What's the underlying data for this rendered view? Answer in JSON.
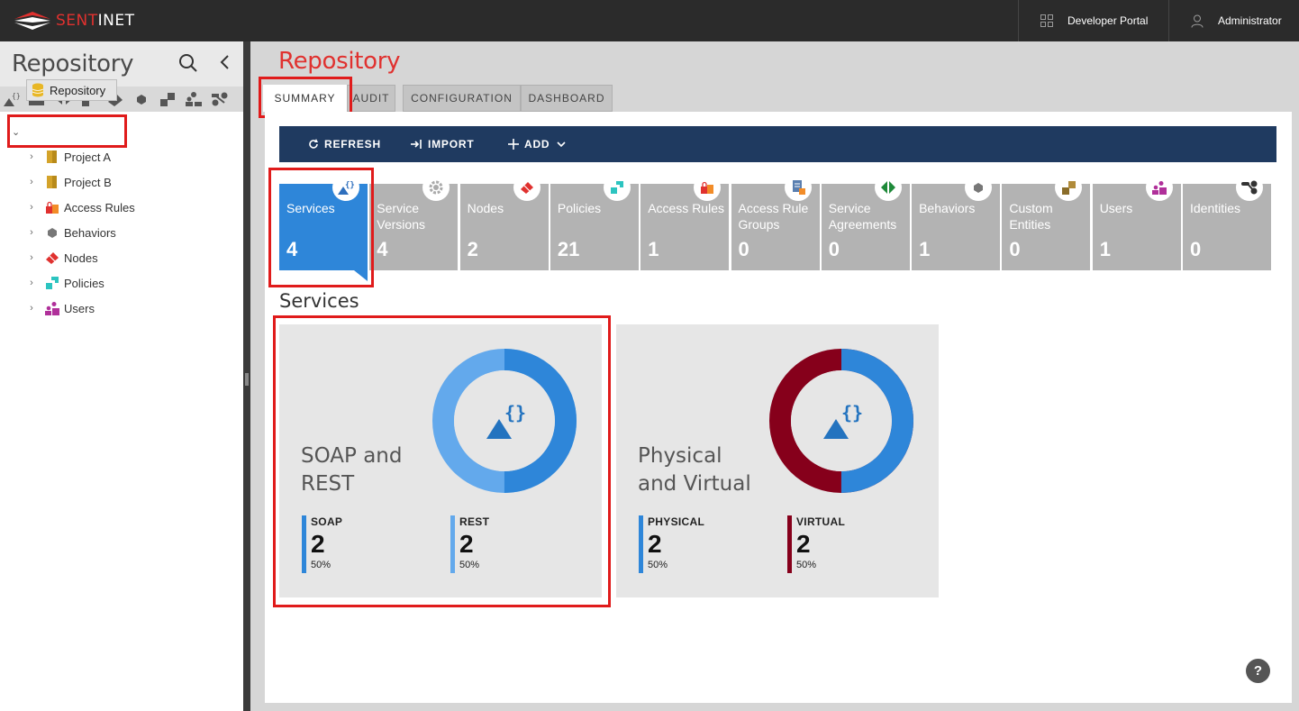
{
  "app": {
    "logo_text_red": "SENT",
    "logo_text_white": "INET"
  },
  "topbar": {
    "developer_portal": "Developer Portal",
    "user": "Administrator"
  },
  "left": {
    "title": "Repository",
    "toolbar_icons": [
      "service-icon",
      "access-rule-icon",
      "service-agreement-icon",
      "policy-icon",
      "node-icon",
      "behavior-icon",
      "custom-entity-icon",
      "users-icon",
      "identity-icon"
    ],
    "root": "Repository",
    "tree": [
      {
        "label": "Project A",
        "icon": "project-icon",
        "color": "#d4a32a"
      },
      {
        "label": "Project B",
        "icon": "project-icon",
        "color": "#d4a32a"
      },
      {
        "label": "Access Rules",
        "icon": "access-rule-icon",
        "color": "#f28c28"
      },
      {
        "label": "Behaviors",
        "icon": "behavior-icon",
        "color": "#777777"
      },
      {
        "label": "Nodes",
        "icon": "node-icon",
        "color": "#e0312f"
      },
      {
        "label": "Policies",
        "icon": "policy-icon",
        "color": "#2cc4c0"
      },
      {
        "label": "Users",
        "icon": "users-icon",
        "color": "#b0309a"
      }
    ]
  },
  "main": {
    "title": "Repository",
    "tabs": [
      "SUMMARY",
      "AUDIT",
      "CONFIGURATION",
      "DASHBOARD"
    ],
    "actions": {
      "refresh": "REFRESH",
      "import": "IMPORT",
      "add": "ADD"
    },
    "tiles": [
      {
        "label": "Services",
        "count": "4",
        "icon": "service-icon",
        "color": "#2e6fbd"
      },
      {
        "label": "Service Versions",
        "count": "4",
        "icon": "gear-icon",
        "color": "#aaaaaa"
      },
      {
        "label": "Nodes",
        "count": "2",
        "icon": "node-icon",
        "color": "#e0312f"
      },
      {
        "label": "Policies",
        "count": "21",
        "icon": "policy-icon",
        "color": "#2cc4c0"
      },
      {
        "label": "Access Rules",
        "count": "1",
        "icon": "access-rule-icon",
        "color": "#f28c28"
      },
      {
        "label": "Access Rule Groups",
        "count": "0",
        "icon": "access-rule-group-icon",
        "color": "#f28c28"
      },
      {
        "label": "Service Agreements",
        "count": "0",
        "icon": "service-agreement-icon",
        "color": "#1f8a3a"
      },
      {
        "label": "Behaviors",
        "count": "1",
        "icon": "behavior-icon",
        "color": "#777777"
      },
      {
        "label": "Custom Entities",
        "count": "0",
        "icon": "custom-entity-icon",
        "color": "#8a6d2a"
      },
      {
        "label": "Users",
        "count": "1",
        "icon": "users-icon",
        "color": "#b0309a"
      },
      {
        "label": "Identities",
        "count": "0",
        "icon": "identity-icon",
        "color": "#333333"
      }
    ],
    "section_title": "Services",
    "cards": [
      {
        "title": "SOAP and REST",
        "stats": [
          {
            "label": "SOAP",
            "value": "2",
            "pct": "50%",
            "fraction": 0.5,
            "color": "#2e86d9"
          },
          {
            "label": "REST",
            "value": "2",
            "pct": "50%",
            "fraction": 0.5,
            "color": "#63a9ec"
          }
        ]
      },
      {
        "title": "Physical and Virtual",
        "stats": [
          {
            "label": "PHYSICAL",
            "value": "2",
            "pct": "50%",
            "fraction": 0.5,
            "color": "#2e86d9"
          },
          {
            "label": "VIRTUAL",
            "value": "2",
            "pct": "50%",
            "fraction": 0.5,
            "color": "#86001b"
          }
        ]
      }
    ]
  },
  "help": "?"
}
